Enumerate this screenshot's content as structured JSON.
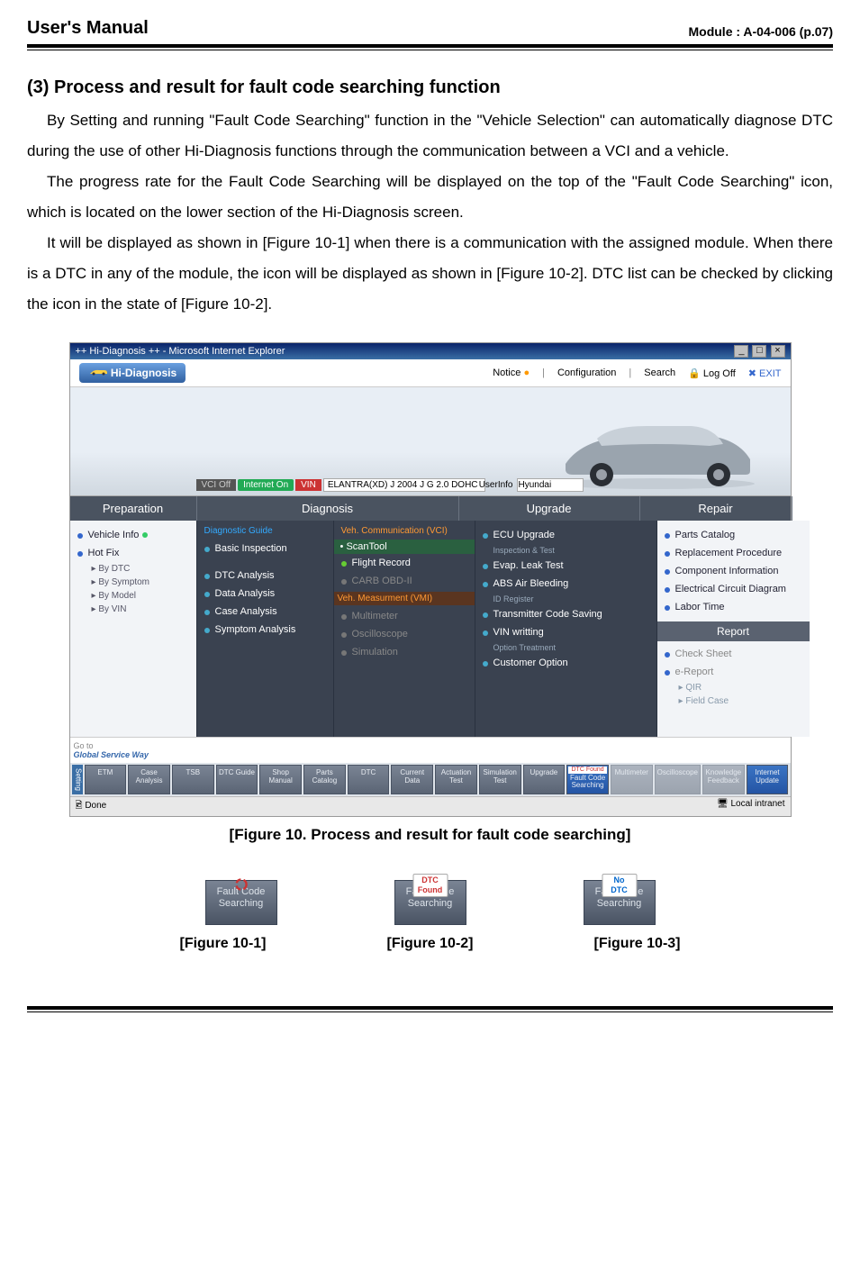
{
  "header": {
    "title": "User's Manual",
    "module": "Module : A-04-006 (p.07)"
  },
  "section": {
    "heading": "(3) Process and result for fault code searching function"
  },
  "paragraphs": {
    "p1": "By Setting and running \"Fault Code Searching\" function in the \"Vehicle Selection\" can automatically diagnose DTC during the use of other Hi-Diagnosis functions through the communication between a VCI and a vehicle.",
    "p2": "The progress rate for the Fault Code Searching will be displayed on the top of the \"Fault Code Searching\" icon, which is located on the lower section of the Hi-Diagnosis screen.",
    "p3": "It will be displayed as shown in [Figure 10-1] when there is a communication with the assigned module. When there is a DTC in any of the module, the icon will be displayed as shown in [Figure 10-2]. DTC list can be checked by clicking the icon in the state of [Figure 10-2]."
  },
  "figure_caption": "[Figure 10. Process and result for fault code searching]",
  "icon_figs": {
    "f1": {
      "label": "Fault Code Searching",
      "caption": "[Figure 10-1]"
    },
    "f2": {
      "badge": "DTC Found",
      "label": "Fault Code Searching",
      "caption": "[Figure  10-2]"
    },
    "f3": {
      "badge": "No DTC",
      "label": "Fault Code Searching",
      "caption": "[Figure  10-3]"
    }
  },
  "shot": {
    "window_title": "++ Hi-Diagnosis ++ - Microsoft Internet Explorer",
    "logo": "Hi-Diagnosis",
    "topbar": {
      "notice": "Notice",
      "config": "Configuration",
      "search": "Search",
      "logoff": "Log Off",
      "exit": "EXIT"
    },
    "vin": {
      "pill1": "VCI Off",
      "pill2": "Internet On",
      "vin_label": "VIN",
      "vin_value": "ELANTRA(XD) J 2004 J G 2.0 DOHC",
      "userinfo_label": "UserInfo",
      "userinfo_value": "Hyundai"
    },
    "cats": {
      "prep": "Preparation",
      "diag": "Diagnosis",
      "upg": "Upgrade",
      "rep": "Repair"
    },
    "col1": {
      "vehicle_info": "Vehicle Info",
      "hotfix": "Hot Fix",
      "by_dtc": "By DTC",
      "by_symptom": "By Symptom",
      "by_model": "By Model",
      "by_vin": "By VIN"
    },
    "col2": {
      "head": "Diagnostic Guide",
      "basic": "Basic Inspection",
      "dtc": "DTC Analysis",
      "data": "Data Analysis",
      "casea": "Case Analysis",
      "symptom": "Symptom Analysis"
    },
    "col3": {
      "head": "Veh. Communication (VCI)",
      "scantool": "ScanTool",
      "flight": "Flight Record",
      "carb": "CARB OBD-II",
      "vmi_head": "Veh. Measurment (VMI)",
      "multi": "Multimeter",
      "osc": "Oscilloscope",
      "sim": "Simulation"
    },
    "col4": {
      "ecu": "ECU Upgrade",
      "sub1": "Inspection & Test",
      "evap": "Evap. Leak Test",
      "abs": "ABS Air Bleeding",
      "sub2": "ID Register",
      "trans": "Transmitter Code Saving",
      "vinw": "VIN writting",
      "sub3": "Option Treatment",
      "cust": "Customer Option"
    },
    "col5": {
      "parts": "Parts Catalog",
      "replace": "Replacement Procedure",
      "comp": "Component Information",
      "elec": "Electrical Circuit Diagram",
      "labor": "Labor Time",
      "report": "Report",
      "check": "Check Sheet",
      "erep": "e-Report",
      "qir": "QIR",
      "field": "Field Case"
    },
    "goto": "Go to",
    "gsw": "Global Service Way",
    "bottom_btns": {
      "b1": "ETM",
      "b2": "Case Analysis",
      "b3": "TSB",
      "b4": "DTC Guide",
      "b5": "Shop Manual",
      "b6": "Parts Catalog",
      "b7": "DTC",
      "b8": "Current Data",
      "b9": "Actuation Test",
      "b10": "Simulation Test",
      "b11": "Upgrade",
      "b12a": "DTC Found",
      "b12": "Fault Code Searching",
      "b13": "Multimeter",
      "b14": "Oscilloscope",
      "b15": "Knowledge Feedback",
      "b16": "Internet Update"
    },
    "status_left": "Done",
    "status_right": "Local intranet"
  }
}
